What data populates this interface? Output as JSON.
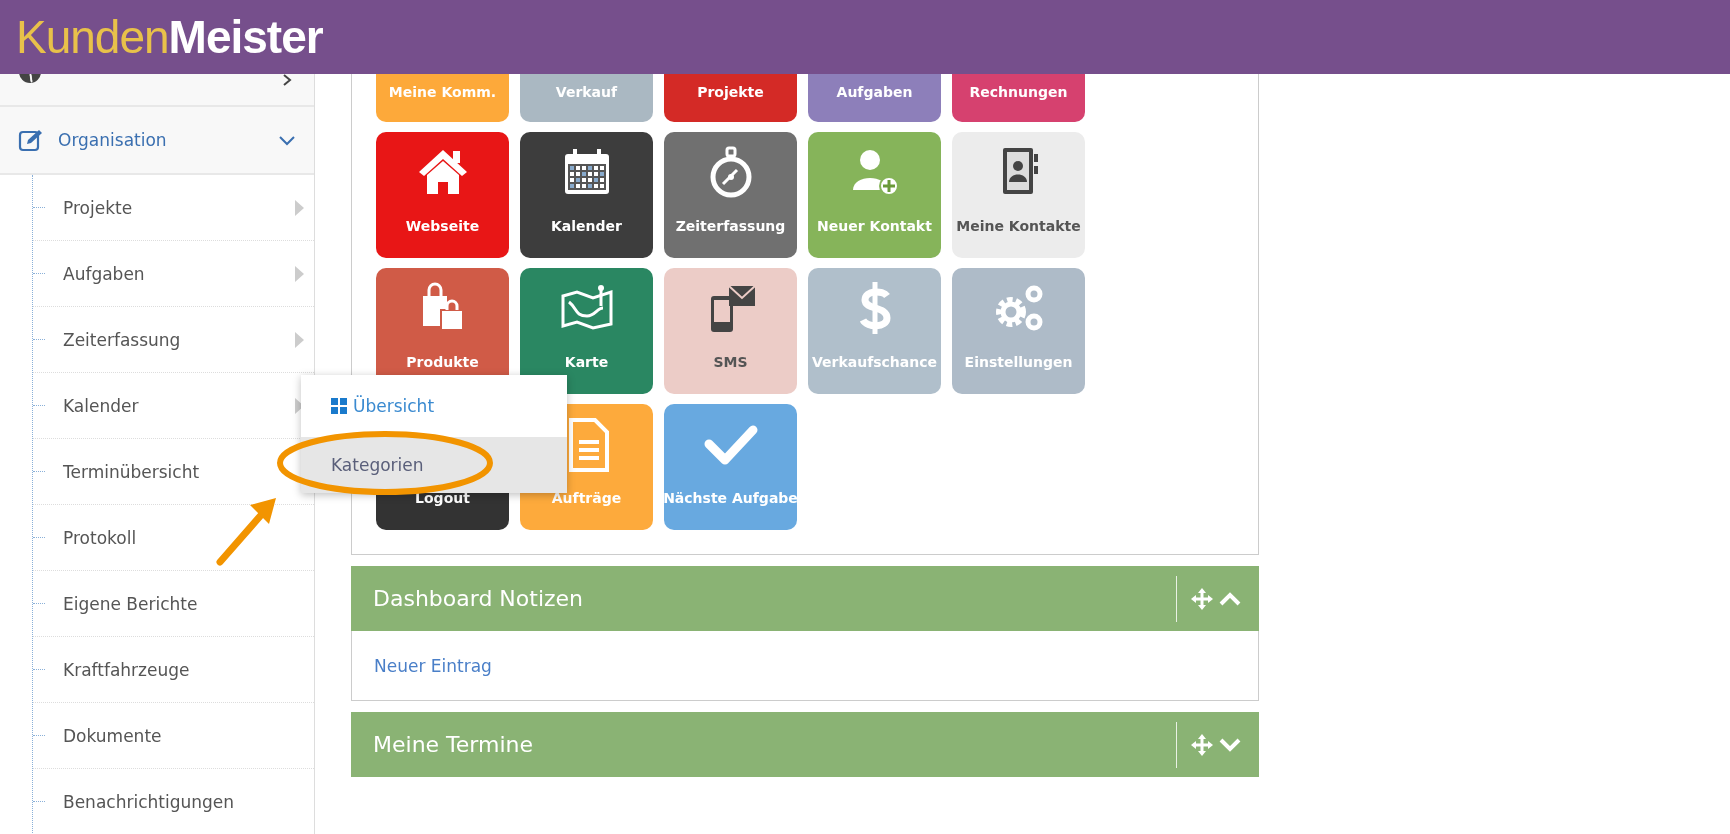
{
  "header": {
    "logo": [
      "Kunden",
      "Meister"
    ]
  },
  "sidebar": {
    "items": [
      {
        "expanded": false
      },
      {
        "label": "Organisation",
        "expanded": true,
        "children": [
          {
            "label": "Projekte",
            "has_submenu": true
          },
          {
            "label": "Aufgaben",
            "has_submenu": true
          },
          {
            "label": "Zeiterfassung",
            "has_submenu": true
          },
          {
            "label": "Kalender",
            "has_submenu": true
          },
          {
            "label": "Terminübersicht",
            "has_submenu": false
          },
          {
            "label": "Protokoll",
            "has_submenu": false
          },
          {
            "label": "Eigene Berichte",
            "has_submenu": false
          },
          {
            "label": "Kraftfahrzeuge",
            "has_submenu": false
          },
          {
            "label": "Dokumente",
            "has_submenu": false
          },
          {
            "label": "Benachrichtigungen",
            "has_submenu": false
          }
        ]
      }
    ]
  },
  "submenu": {
    "items": [
      {
        "label": "Übersicht",
        "selected": false
      },
      {
        "label": "Kategorien",
        "selected": true
      }
    ]
  },
  "tiles": [
    {
      "label": "Meine Komm.",
      "color": "#fda93a"
    },
    {
      "label": "Verkauf",
      "color": "#aab8c2"
    },
    {
      "label": "Projekte",
      "color": "#d42a26"
    },
    {
      "label": "Aufgaben",
      "color": "#8d7fba"
    },
    {
      "label": "Rechnungen",
      "color": "#d6416f"
    },
    {
      "label": "Webseite",
      "color": "#e81616"
    },
    {
      "label": "Kalender",
      "color": "#3d3d3d"
    },
    {
      "label": "Zeiterfassung",
      "color": "#707070"
    },
    {
      "label": "Neuer Kontakt",
      "color": "#86b45a"
    },
    {
      "label": "Meine Kontakte",
      "color": "#ececec"
    },
    {
      "label": "Produkte",
      "color": "#d05b47"
    },
    {
      "label": "Karte",
      "color": "#2a8762"
    },
    {
      "label": "SMS",
      "color": "#ecccc7"
    },
    {
      "label": "Verkaufschance",
      "color": "#b0bfcb"
    },
    {
      "label": "Einstellungen",
      "color": "#aebbc8"
    },
    {
      "label": "Logout",
      "color": "#333333"
    },
    {
      "label": "Aufträge",
      "color": "#fdaa3c"
    },
    {
      "label": "Nächste Aufgabe",
      "color": "#68a9e0"
    }
  ],
  "panels": [
    {
      "title": "Dashboard Notizen",
      "expanded": true,
      "link": "Neuer Eintrag"
    },
    {
      "title": "Meine Termine",
      "expanded": false
    }
  ]
}
